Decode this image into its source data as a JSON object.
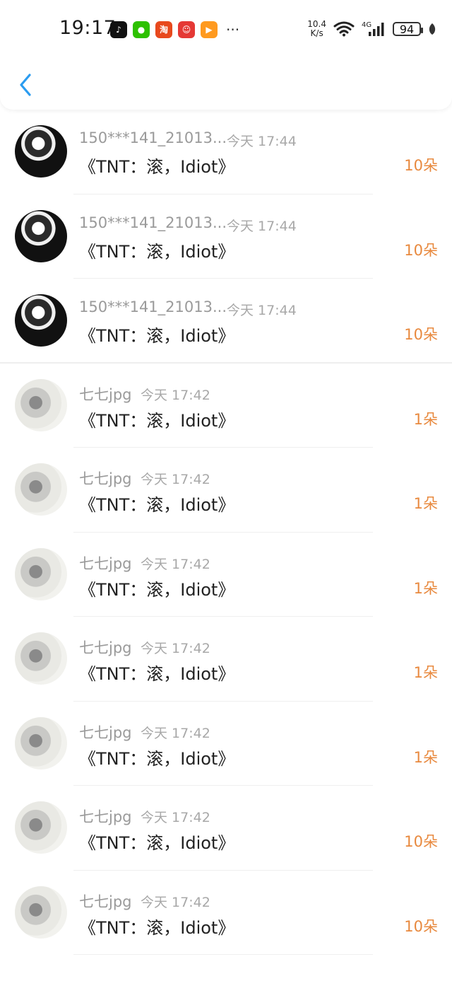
{
  "status_bar": {
    "time": "19:17",
    "net_speed_value": "10.4",
    "net_speed_unit": "K/s",
    "network_type": "4G",
    "battery_level": "94",
    "app_icons": [
      "tiktok-icon",
      "wechat-icon",
      "taobao-icon",
      "red-app-icon",
      "orange-app-icon"
    ],
    "more": "···"
  },
  "header": {
    "back_icon": "chevron-left-icon"
  },
  "colors": {
    "accent": "#2b9cf0",
    "amount": "#e8893e",
    "muted_text": "#9a9a9a",
    "primary_text": "#222222"
  },
  "items": [
    {
      "user": "150***141_21013...",
      "time": "今天 17:44",
      "title": "《TNT：滚，Idiot》",
      "amount": "10朵"
    },
    {
      "user": "150***141_21013...",
      "time": "今天 17:44",
      "title": "《TNT：滚，Idiot》",
      "amount": "10朵"
    },
    {
      "user": "150***141_21013...",
      "time": "今天 17:44",
      "title": "《TNT：滚，Idiot》",
      "amount": "10朵"
    },
    {
      "user": "七七jpg",
      "time": "今天 17:42",
      "title": "《TNT：滚，Idiot》",
      "amount": "1朵"
    },
    {
      "user": "七七jpg",
      "time": "今天 17:42",
      "title": "《TNT：滚，Idiot》",
      "amount": "1朵"
    },
    {
      "user": "七七jpg",
      "time": "今天 17:42",
      "title": "《TNT：滚，Idiot》",
      "amount": "1朵"
    },
    {
      "user": "七七jpg",
      "time": "今天 17:42",
      "title": "《TNT：滚，Idiot》",
      "amount": "1朵"
    },
    {
      "user": "七七jpg",
      "time": "今天 17:42",
      "title": "《TNT：滚，Idiot》",
      "amount": "1朵"
    },
    {
      "user": "七七jpg",
      "time": "今天 17:42",
      "title": "《TNT：滚，Idiot》",
      "amount": "10朵"
    },
    {
      "user": "七七jpg",
      "time": "今天 17:42",
      "title": "《TNT：滚，Idiot》",
      "amount": "10朵"
    }
  ]
}
